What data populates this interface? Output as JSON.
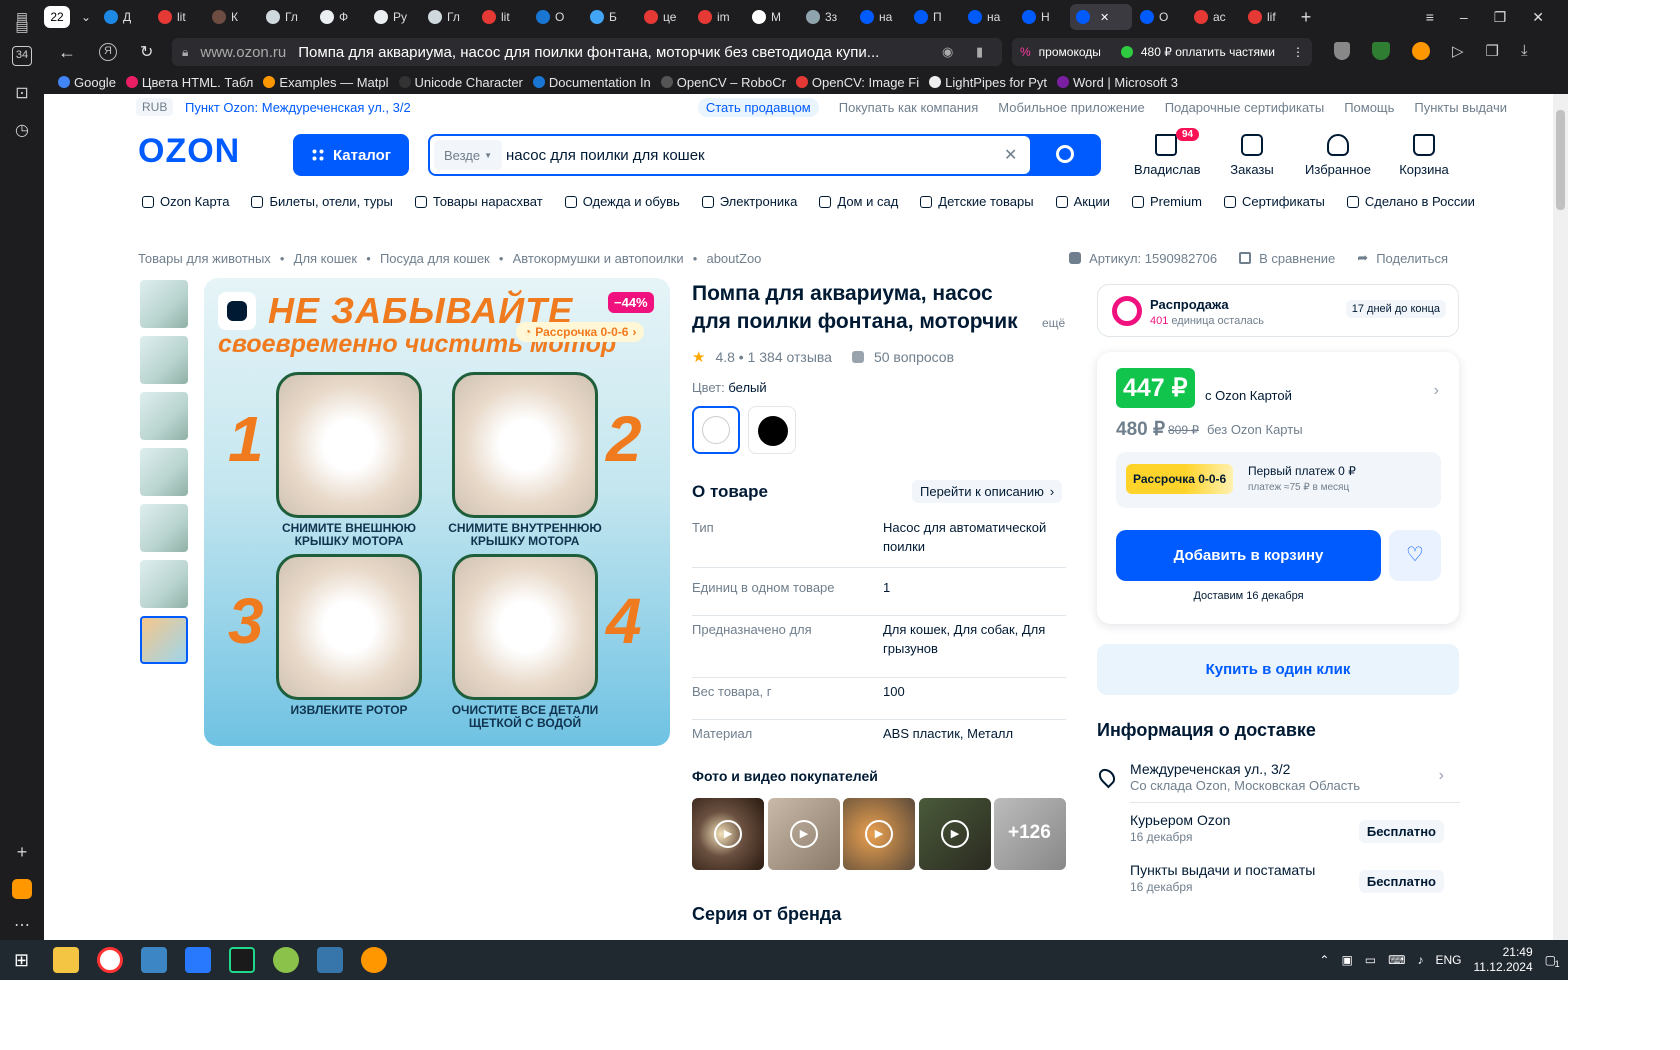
{
  "browser": {
    "tab_count": "22",
    "tabs": [
      {
        "label": "Д",
        "color": "#1e88e5"
      },
      {
        "label": "lit",
        "color": "#e53935"
      },
      {
        "label": "К",
        "color": "#6d4c41"
      },
      {
        "label": "Гл",
        "color": "#cfd8dc"
      },
      {
        "label": "Ф",
        "color": "#eceff1"
      },
      {
        "label": "Ру",
        "color": "#eceff1"
      },
      {
        "label": "Гл",
        "color": "#cfd8dc"
      },
      {
        "label": "lit",
        "color": "#e53935"
      },
      {
        "label": "О",
        "color": "#1976d2"
      },
      {
        "label": "Б",
        "color": "#42a5f5"
      },
      {
        "label": "це",
        "color": "#e53935"
      },
      {
        "label": "im",
        "color": "#e53935"
      },
      {
        "label": "М",
        "color": "#ffffff"
      },
      {
        "label": "3з",
        "color": "#90a4ae"
      },
      {
        "label": "на",
        "color": "#005bff"
      },
      {
        "label": "П",
        "color": "#005bff"
      },
      {
        "label": "на",
        "color": "#005bff"
      },
      {
        "label": "Н",
        "color": "#005bff"
      },
      {
        "label": "",
        "color": "#005bff",
        "active": true
      },
      {
        "label": "О",
        "color": "#005bff"
      },
      {
        "label": "ас",
        "color": "#e53935"
      },
      {
        "label": "lif",
        "color": "#e53935"
      }
    ],
    "url": "www.ozon.ru",
    "page_title": "Помпа для аквариума, насос для поилки фонтана, моторчик без светодиода купи...",
    "promo1": "промокоды",
    "promo2": "480 ₽ оплатить частями",
    "bookmarks": [
      {
        "label": "Google",
        "color": "#4285f4"
      },
      {
        "label": "Цвета HTML. Табл",
        "color": "#e91e63"
      },
      {
        "label": "Examples — Matpl",
        "color": "#ff9800"
      },
      {
        "label": "Unicode Character",
        "color": "#333"
      },
      {
        "label": "Documentation In",
        "color": "#1976d2"
      },
      {
        "label": "OpenCV – RoboCr",
        "color": "#555"
      },
      {
        "label": "OpenCV: Image Fi",
        "color": "#e53935"
      },
      {
        "label": "LightPipes for Pyt",
        "color": "#eee"
      },
      {
        "label": "Word | Microsoft 3",
        "color": "#7b1fa2"
      }
    ],
    "rail_badge": "34"
  },
  "top": {
    "currency": "RUB",
    "pickup": "Пункт Ozon: Междуреченская ул., 3/2",
    "links": [
      "Стать продавцом",
      "Покупать как компания",
      "Мобильное приложение",
      "Подарочные сертификаты",
      "Помощь",
      "Пункты выдачи"
    ]
  },
  "header": {
    "logo": "OZON",
    "catalog": "Каталог",
    "scope": "Везде",
    "query": "насос для поилки для кошек",
    "user": "Владислав",
    "user_badge": "94",
    "orders": "Заказы",
    "favorites": "Избранное",
    "cart": "Корзина"
  },
  "catnav": [
    "Ozon Карта",
    "Билеты, отели, туры",
    "Товары нарасхват",
    "Одежда и обувь",
    "Электроника",
    "Дом и сад",
    "Детские товары",
    "Акции",
    "Premium",
    "Сертификаты",
    "Сделано в России"
  ],
  "breadcrumbs": [
    "Товары для животных",
    "Для кошек",
    "Посуда для кошек",
    "Автокормушки и автопоилки",
    "aboutZoo"
  ],
  "article": "Артикул: 1590982706",
  "compare": "В сравнение",
  "share": "Поделиться",
  "image": {
    "discount": "−44%",
    "installment": "Рассрочка 0-0-6",
    "headline1": "НЕ ЗАБЫВАЙТЕ",
    "headline2": "своевременно чистить мотор",
    "steps": [
      {
        "num": "1",
        "text": "СНИМИТЕ ВНЕШНЮЮ КРЫШКУ МОТОРА"
      },
      {
        "num": "2",
        "text": "СНИМИТЕ ВНУТРЕННЮЮ КРЫШКУ МОТОРА"
      },
      {
        "num": "3",
        "text": "ИЗВЛЕКИТЕ РОТОР"
      },
      {
        "num": "4",
        "text": "ОЧИСТИТЕ ВСЕ ДЕТАЛИ ЩЕТКОЙ С ВОДОЙ"
      }
    ]
  },
  "product": {
    "title": "Помпа для аквариума, насос для поилки фонтана, моторчик бе",
    "more": "ещё",
    "rating": "4.8 • 1 384 отзыва",
    "questions": "50 вопросов",
    "color_label": "Цвет:",
    "color_value": "белый",
    "about": "О товаре",
    "to_desc": "Перейти к описанию",
    "specs": [
      {
        "k": "Тип",
        "v": "Насос для автоматической поилки"
      },
      {
        "k": "Единиц в одном товаре",
        "v": "1"
      },
      {
        "k": "Предназначено для",
        "v": "Для кошек, Для собак, Для грызунов"
      },
      {
        "k": "Вес товара, г",
        "v": "100"
      },
      {
        "k": "Материал",
        "v": "ABS пластик, Металл"
      }
    ],
    "photos_title": "Фото и видео покупателей",
    "photos_more": "+126",
    "series": "Серия от бренда"
  },
  "sale": {
    "title": "Распродажа",
    "left_num": "401",
    "left_text": "единица осталась",
    "days": "17 дней до конца"
  },
  "price": {
    "card_price": "447 ₽",
    "card_label": "с Ozon Картой",
    "price": "480 ₽",
    "old": "809 ₽",
    "no_card": "без Ozon Карты",
    "installment_badge": "Рассрочка 0-0-6",
    "first_payment": "Первый платеж 0 ₽",
    "monthly": "платеж ≈75 ₽ в месяц",
    "add_cart": "Добавить в корзину",
    "delivery_date": "Доставим 16 декабря",
    "one_click": "Купить в один клик"
  },
  "delivery": {
    "title": "Информация о доставке",
    "address": "Междуреченская ул., 3/2",
    "warehouse": "Со склада Ozon, Московская Область",
    "options": [
      {
        "name": "Курьером Ozon",
        "date": "16 декабря",
        "price": "Бесплатно"
      },
      {
        "name": "Пункты выдачи и постаматы",
        "date": "16 декабря",
        "price": "Бесплатно"
      }
    ]
  },
  "taskbar": {
    "lang": "ENG",
    "time": "21:49",
    "date": "11.12.2024",
    "notif": "1"
  }
}
